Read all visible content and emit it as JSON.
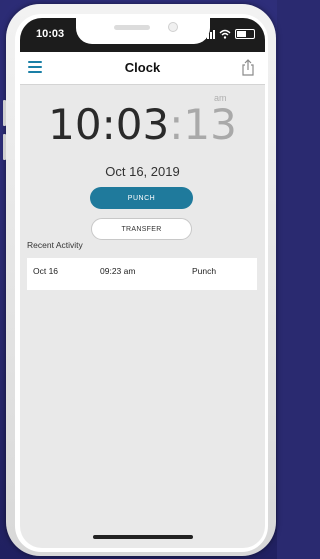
{
  "status_bar": {
    "time": "10:03"
  },
  "nav": {
    "title": "Clock"
  },
  "clock": {
    "hours_minutes": "10:03",
    "seconds": ":13",
    "period": "am",
    "date": "Oct 16, 2019"
  },
  "actions": {
    "punch_label": "PUNCH",
    "transfer_label": "TRANSFER"
  },
  "recent_activity": {
    "title": "Recent Activity",
    "rows": [
      {
        "date": "Oct 16",
        "time": "09:23 am",
        "type": "Punch"
      }
    ]
  },
  "colors": {
    "accent": "#1f7a9c",
    "menu_icon": "#1a7fa6",
    "background": "#2a2a70",
    "screen_background": "#e9e9e9"
  },
  "icons": {
    "menu": "hamburger-menu-icon",
    "share": "share-icon",
    "signal": "signal-icon",
    "wifi": "wifi-icon",
    "battery": "battery-icon"
  }
}
